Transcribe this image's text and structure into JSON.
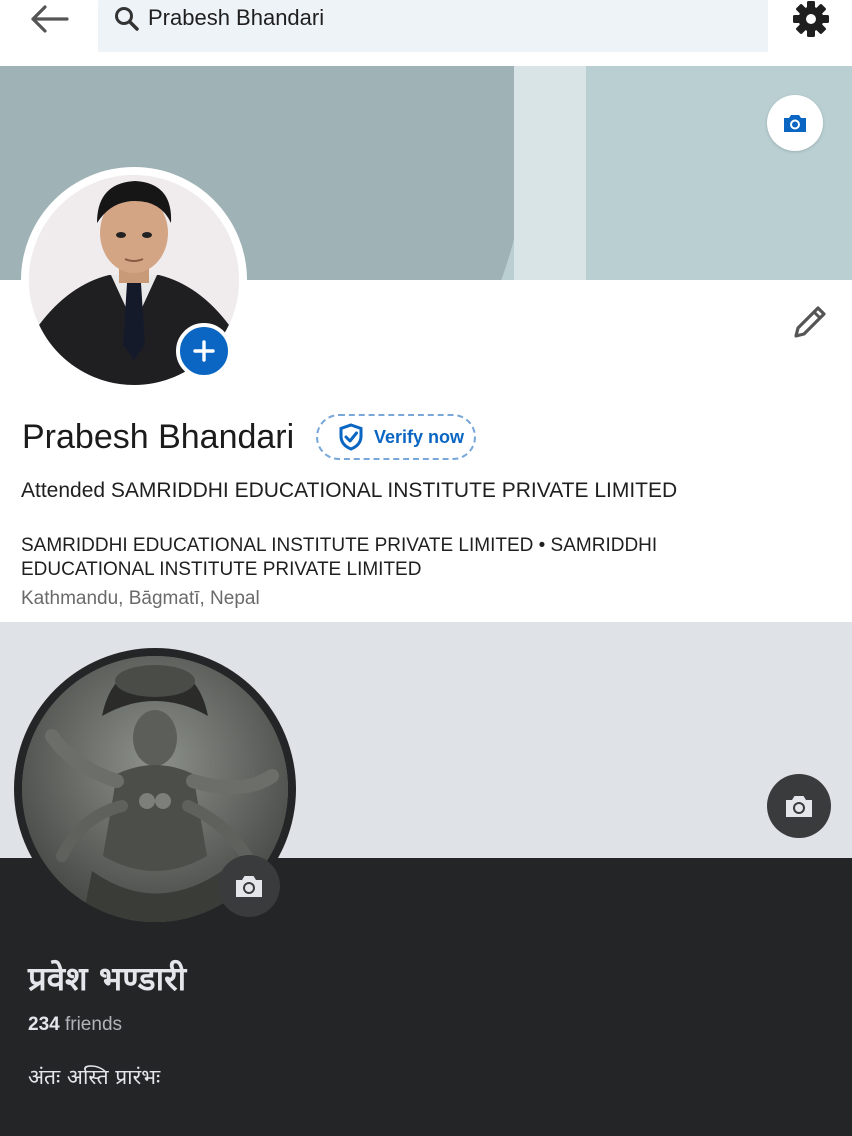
{
  "search": {
    "value": "Prabesh Bhandari"
  },
  "icons": {
    "back": "arrow-left-icon",
    "search": "search-icon",
    "settings": "gear-icon",
    "cover_camera": "camera-icon",
    "add_photo": "plus-icon",
    "edit": "pencil-icon",
    "verify": "shield-check-icon"
  },
  "profile": {
    "name": "Prabesh Bhandari",
    "verify_label": "Verify now",
    "headline": "Attended SAMRIDDHI EDUCATIONAL INSTITUTE PRIVATE LIMITED",
    "education": "SAMRIDDHI EDUCATIONAL INSTITUTE PRIVATE LIMITED • SAMRIDDHI EDUCATIONAL INSTITUTE PRIVATE LIMITED",
    "location": "Kathmandu, Bāgmatī, Nepal"
  },
  "fb_profile": {
    "name": "प्रवेश भण्डारी",
    "friends_count": "234",
    "friends_label": "friends",
    "bio": "अंतः अस्ति प्रारंभः"
  },
  "colors": {
    "accent_blue": "#0a66c2",
    "cover_gray": "#b9cfd2",
    "dark_surface": "#242526",
    "dark_button": "#3a3b3c"
  }
}
